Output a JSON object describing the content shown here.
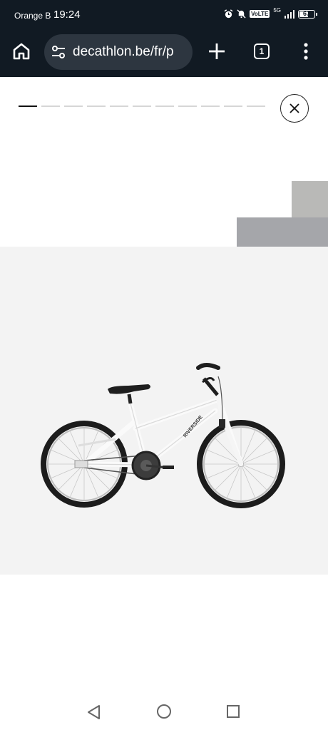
{
  "status_bar": {
    "carrier": "Orange B",
    "time": "19:24",
    "volte": "VoLTE",
    "network": "5G",
    "battery": "67",
    "battery_level": 0.67,
    "icons": [
      "alarm-icon",
      "bell-off-icon",
      "signal-icon",
      "battery-icon"
    ]
  },
  "browser": {
    "url": "decathlon.be/fr/p",
    "tab_count": "1",
    "icons": [
      "home-icon",
      "tune-icon",
      "plus-icon",
      "tabs-icon",
      "more-vert-icon"
    ]
  },
  "viewer": {
    "progress_segments": 11,
    "active_segment": 1,
    "close_icon": "close-icon"
  },
  "product_image": {
    "frame_text": "RIVERSIDE"
  },
  "nav_bar": {
    "icons": [
      "back-icon",
      "home-circle-icon",
      "recent-apps-icon"
    ]
  },
  "colors": {
    "toolbar_bg": "#111a23",
    "url_pill_bg": "#2d3640",
    "image_bg": "#f3f3f3"
  }
}
